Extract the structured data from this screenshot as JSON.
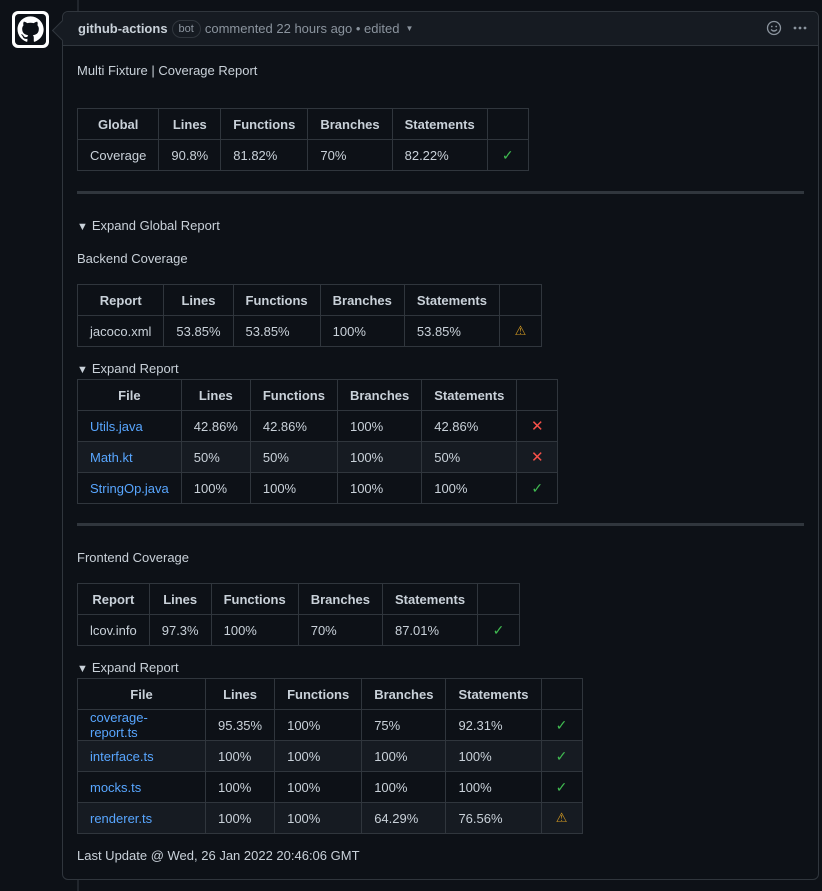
{
  "header": {
    "author": "github-actions",
    "badge": "bot",
    "meta": "commented 22 hours ago • edited"
  },
  "title": "Multi Fixture | Coverage Report",
  "global": {
    "headers": [
      "Global",
      "Lines",
      "Functions",
      "Branches",
      "Statements",
      ""
    ],
    "row": {
      "label": "Coverage",
      "lines": "90.8%",
      "functions": "81.82%",
      "branches": "70%",
      "statements": "82.22%",
      "status": "check-icon"
    }
  },
  "expand_global": "Expand Global Report",
  "backend": {
    "title": "Backend Coverage",
    "headers": [
      "Report",
      "Lines",
      "Functions",
      "Branches",
      "Statements",
      ""
    ],
    "row": {
      "label": "jacoco.xml",
      "lines": "53.85%",
      "functions": "53.85%",
      "branches": "100%",
      "statements": "53.85%",
      "status": "warning-icon"
    },
    "expand": "Expand Report",
    "file_headers": [
      "File",
      "Lines",
      "Functions",
      "Branches",
      "Statements",
      ""
    ],
    "files": [
      {
        "name": "Utils.java",
        "lines": "42.86%",
        "functions": "42.86%",
        "branches": "100%",
        "statements": "42.86%",
        "status": "cross-icon"
      },
      {
        "name": "Math.kt",
        "lines": "50%",
        "functions": "50%",
        "branches": "100%",
        "statements": "50%",
        "status": "cross-icon"
      },
      {
        "name": "StringOp.java",
        "lines": "100%",
        "functions": "100%",
        "branches": "100%",
        "statements": "100%",
        "status": "check-icon"
      }
    ]
  },
  "frontend": {
    "title": "Frontend Coverage",
    "headers": [
      "Report",
      "Lines",
      "Functions",
      "Branches",
      "Statements",
      ""
    ],
    "row": {
      "label": "lcov.info",
      "lines": "97.3%",
      "functions": "100%",
      "branches": "70%",
      "statements": "87.01%",
      "status": "check-icon"
    },
    "expand": "Expand Report",
    "file_headers": [
      "File",
      "Lines",
      "Functions",
      "Branches",
      "Statements",
      ""
    ],
    "files": [
      {
        "name": "coverage-report.ts",
        "lines": "95.35%",
        "functions": "100%",
        "branches": "75%",
        "statements": "92.31%",
        "status": "check-icon"
      },
      {
        "name": "interface.ts",
        "lines": "100%",
        "functions": "100%",
        "branches": "100%",
        "statements": "100%",
        "status": "check-icon"
      },
      {
        "name": "mocks.ts",
        "lines": "100%",
        "functions": "100%",
        "branches": "100%",
        "statements": "100%",
        "status": "check-icon"
      },
      {
        "name": "renderer.ts",
        "lines": "100%",
        "functions": "100%",
        "branches": "64.29%",
        "statements": "76.56%",
        "status": "warning-icon"
      }
    ]
  },
  "footer": "Last Update @ Wed, 26 Jan 2022 20:46:06 GMT",
  "colors": {
    "link": "#58a6ff",
    "ok": "#3fb950",
    "fail": "#f85149",
    "warn": "#d29922"
  }
}
